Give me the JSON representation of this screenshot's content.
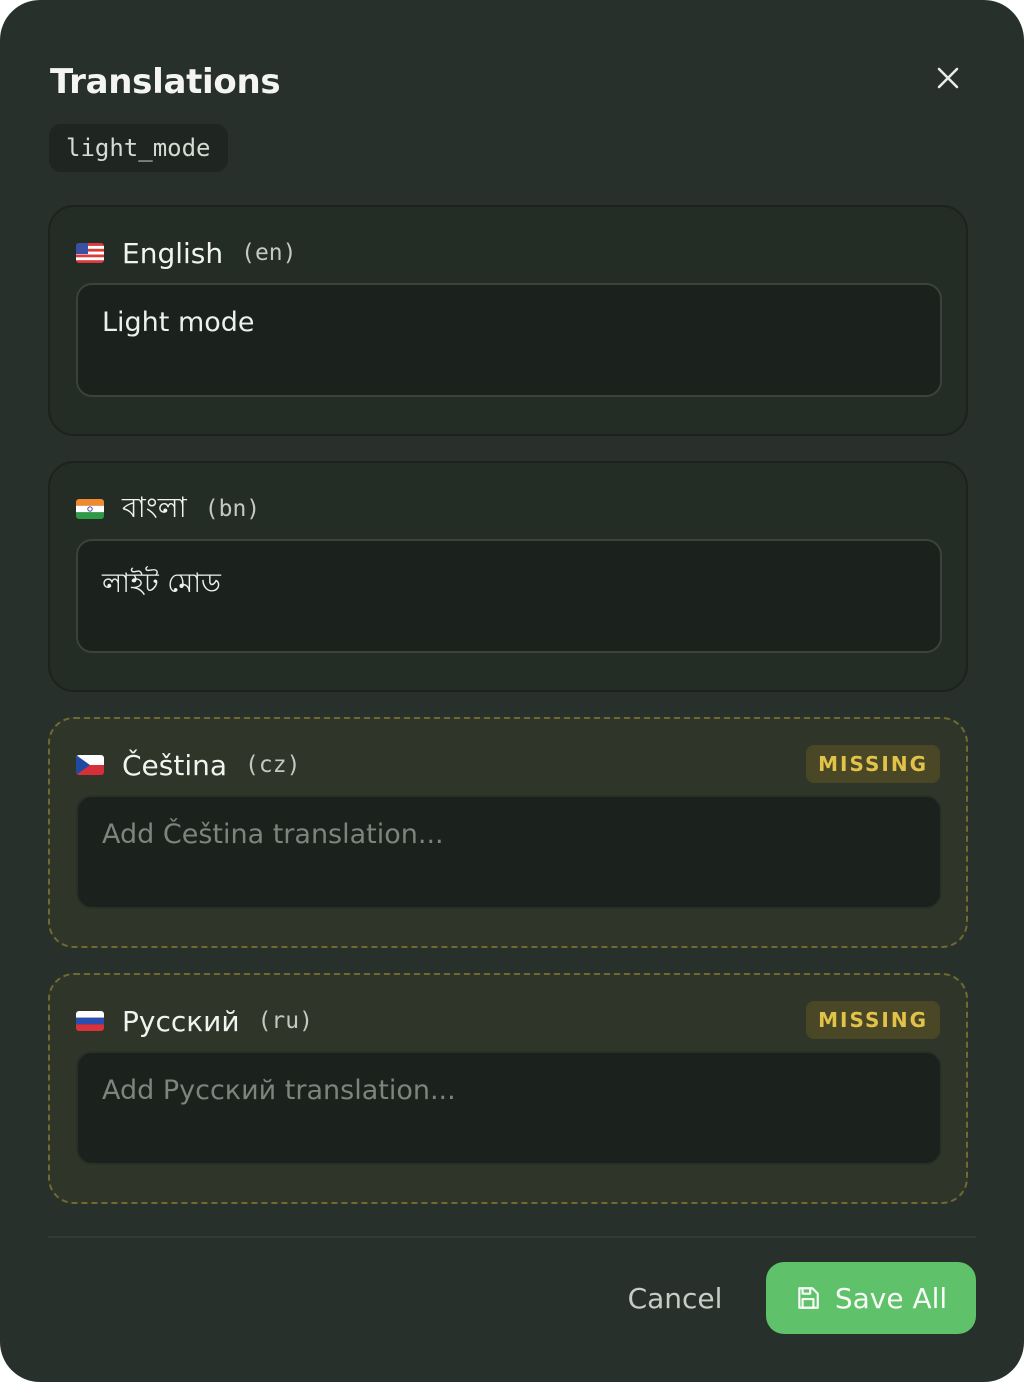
{
  "dialog": {
    "title": "Translations",
    "key": "light_mode",
    "close_icon": "close-icon"
  },
  "languages": [
    {
      "flag": "flag-us-icon",
      "name": "English",
      "code": "(en)",
      "value": "Light mode",
      "placeholder": "",
      "missing": false,
      "badge": ""
    },
    {
      "flag": "flag-in-icon",
      "name": "বাংলা",
      "code": "(bn)",
      "value": "লাইট মোড",
      "placeholder": "",
      "missing": false,
      "badge": ""
    },
    {
      "flag": "flag-cz-icon",
      "name": "Čeština",
      "code": "(cz)",
      "value": "",
      "placeholder": "Add Čeština translation...",
      "missing": true,
      "badge": "MISSING"
    },
    {
      "flag": "flag-ru-icon",
      "name": "Русский",
      "code": "(ru)",
      "value": "",
      "placeholder": "Add Русский translation...",
      "missing": true,
      "badge": "MISSING"
    }
  ],
  "footer": {
    "cancel_label": "Cancel",
    "save_label": "Save All",
    "save_icon": "save-icon"
  },
  "colors": {
    "background": "#27302a",
    "accent": "#5fc16a",
    "missing_badge_text": "#e3c24a",
    "missing_border": "#6e6a30"
  }
}
